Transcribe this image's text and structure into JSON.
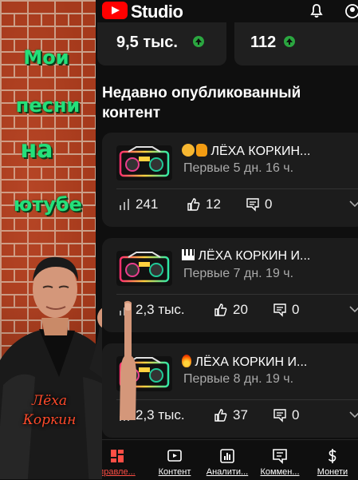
{
  "collage": {
    "caption_lines": [
      "Мои",
      "песни",
      "на",
      "ютубе"
    ],
    "signature_lines": [
      "Лёха",
      "Коркин"
    ]
  },
  "header": {
    "logo_text": "Studio",
    "icons": [
      "youtube-logo-icon",
      "bell-icon",
      "account-icon"
    ]
  },
  "stats": [
    {
      "value": "9,5 тыс.",
      "trend": "up"
    },
    {
      "value": "112",
      "trend": "up"
    }
  ],
  "section_title": "Недавно опубликованный контент",
  "videos": [
    {
      "emoji": [
        "face-emoji",
        "hand-emoji"
      ],
      "title": "ЛЁХА КОРКИН...",
      "subtitle": "Первые 5 дн. 16 ч.",
      "views": "241",
      "likes": "12",
      "comments": "0"
    },
    {
      "emoji": [
        "piano-emoji"
      ],
      "title": "ЛЁХА КОРКИН И...",
      "subtitle": "Первые 7 дн. 19 ч.",
      "views": "2,3 тыс.",
      "likes": "20",
      "comments": "0"
    },
    {
      "emoji": [
        "fire-emoji"
      ],
      "title": "ЛЁХА КОРКИН И...",
      "subtitle": "Первые 8 дн. 19 ч.",
      "views": "2,3 тыс.",
      "likes": "37",
      "comments": "0"
    }
  ],
  "nav": [
    {
      "label": "правле...",
      "icon": "dashboard-icon",
      "active": true
    },
    {
      "label": "Контент",
      "icon": "content-icon",
      "active": false
    },
    {
      "label": "Аналити...",
      "icon": "analytics-icon",
      "active": false
    },
    {
      "label": "Коммен...",
      "icon": "comments-icon",
      "active": false
    },
    {
      "label": "Монети",
      "icon": "monetization-icon",
      "active": false
    }
  ],
  "colors": {
    "accent_red": "#ff0000",
    "trend_green": "#2ba640",
    "caption_green": "#24e07a",
    "signature_red": "#ff4a2a",
    "active_nav": "#ff4e45"
  }
}
